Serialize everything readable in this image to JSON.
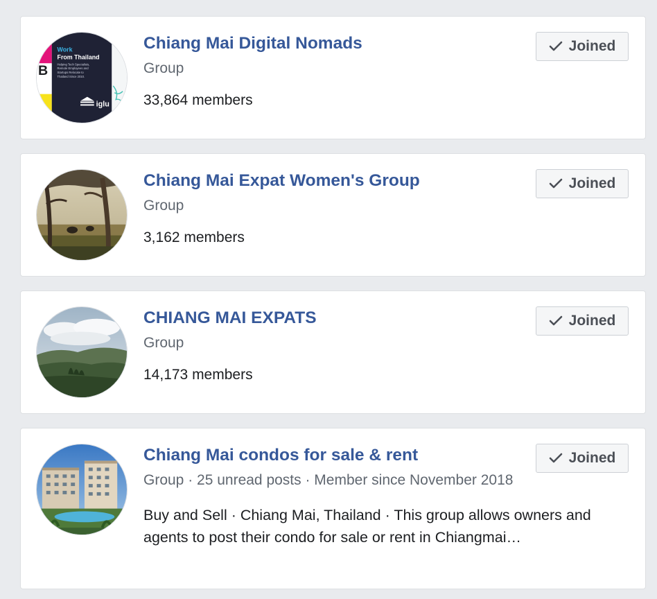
{
  "groups": [
    {
      "name": "Chiang Mai Digital Nomads",
      "type": "Group",
      "members": "33,864 members",
      "button": "Joined",
      "avatar": {
        "headline": "Work",
        "subhead": "From Thailand",
        "body1": "Helping Tech Specialists,",
        "body2": "Remote Employees and",
        "body3": "Startups Relocate to",
        "body4": "Thailand Since 2010.",
        "brand": "iglu",
        "side_letter": "B"
      }
    },
    {
      "name": "Chiang Mai Expat Women's Group",
      "type": "Group",
      "members": "3,162 members",
      "button": "Joined"
    },
    {
      "name": "CHIANG MAI EXPATS",
      "type": "Group",
      "members": "14,173 members",
      "button": "Joined"
    },
    {
      "name": "Chiang Mai condos for sale & rent",
      "type": "Group · 25 unread posts · Member since November 2018",
      "description": "Buy and Sell · Chiang Mai, Thailand · This group allows owners and agents to post their condo for sale or rent in Chiangmai…",
      "button": "Joined"
    }
  ],
  "icons": {
    "joined": "check-icon"
  },
  "colors": {
    "page_bg": "#e9ebee",
    "link_blue": "#365899",
    "secondary_text": "#606770",
    "primary_text": "#1c1e21",
    "button_bg": "#f5f6f7"
  }
}
